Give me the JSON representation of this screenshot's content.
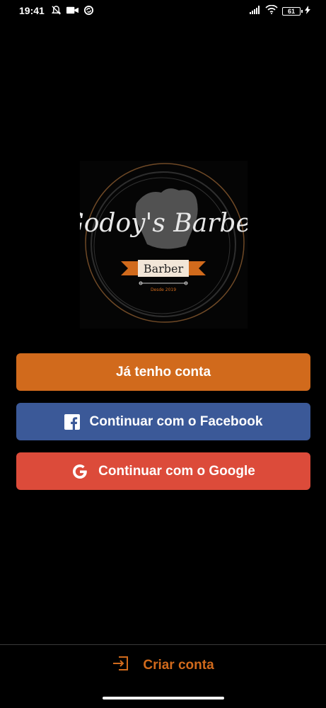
{
  "status_bar": {
    "time": "19:41",
    "battery": "61",
    "icons": [
      "alarm-off-icon",
      "video-camera-icon",
      "sync-icon",
      "signal-icon",
      "wifi-icon",
      "battery-icon",
      "charging-icon"
    ]
  },
  "logo": {
    "alt_text": "Godoy's Barber",
    "accent": "#d16a1c"
  },
  "buttons": {
    "login_label": "Já tenho conta",
    "facebook_label": "Continuar com o Facebook",
    "google_label": "Continuar com o Google"
  },
  "footer": {
    "create_account_label": "Criar conta"
  },
  "colors": {
    "background": "#000000",
    "primary": "#d16a1c",
    "facebook": "#3b5998",
    "google": "#dc4b3a"
  }
}
